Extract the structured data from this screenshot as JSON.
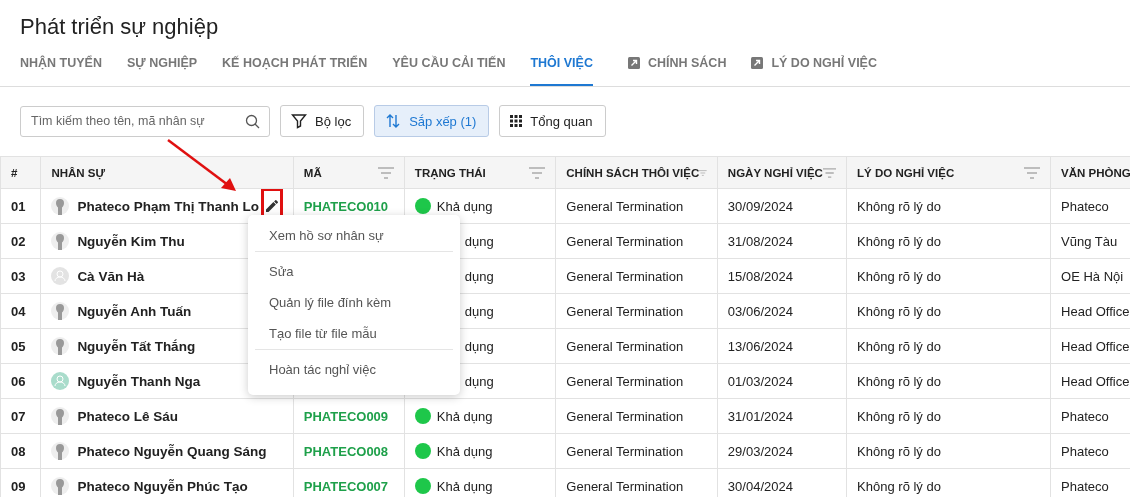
{
  "title": "Phát triển sự nghiệp",
  "tabs": [
    {
      "label": "NHẬN TUYỂN",
      "selected": false,
      "external": false
    },
    {
      "label": "SỰ NGHIỆP",
      "selected": false,
      "external": false
    },
    {
      "label": "KẾ HOẠCH PHÁT TRIỂN",
      "selected": false,
      "external": false
    },
    {
      "label": "YÊU CẦU CẢI TIẾN",
      "selected": false,
      "external": false
    },
    {
      "label": "THÔI VIỆC",
      "selected": true,
      "external": false
    },
    {
      "label": "CHÍNH SÁCH",
      "selected": false,
      "external": true
    },
    {
      "label": "LÝ DO NGHỈ VIỆC",
      "selected": false,
      "external": true
    }
  ],
  "search": {
    "placeholder": "Tìm kiếm theo tên, mã nhân sự"
  },
  "toolbar": [
    {
      "label": "Bộ lọc",
      "kind": "filter",
      "selected": false
    },
    {
      "label": "Sắp xếp (1)",
      "kind": "sort",
      "selected": true
    },
    {
      "label": "Tổng quan",
      "kind": "grid",
      "selected": false
    }
  ],
  "table": {
    "columns": [
      {
        "label": "#",
        "filter": false
      },
      {
        "label": "NHÂN SỰ",
        "filter": false
      },
      {
        "label": "MÃ",
        "filter": true
      },
      {
        "label": "TRẠNG THÁI",
        "filter": true
      },
      {
        "label": "CHÍNH SÁCH THÔI VIỆC",
        "filter": true
      },
      {
        "label": "NGÀY NGHỈ VIỆC",
        "filter": true
      },
      {
        "label": "LÝ DO NGHỈ VIỆC",
        "filter": true
      },
      {
        "label": "VĂN PHÒNG"
      }
    ],
    "rows": [
      {
        "no": "01",
        "avatar": {
          "kind": "photo"
        },
        "name": "Phateco Phạm Thị Thanh Lo",
        "actions": true,
        "code": "PHATECO010",
        "status": {
          "text": "Khả dụng",
          "kind": "dot",
          "color": "#1ec74a"
        },
        "policy": "General Termination",
        "date": "30/09/2024",
        "reason": "Không rõ lý do",
        "office": "Phateco"
      },
      {
        "no": "02",
        "avatar": {
          "kind": "photo"
        },
        "name": "Nguyễn Kim Thu",
        "status": {
          "text": "dụng",
          "kind": "clipped"
        },
        "policy": "General Termination",
        "date": "31/08/2024",
        "reason": "Không rõ lý do",
        "office": "Vũng Tàu"
      },
      {
        "no": "03",
        "avatar": {
          "kind": "blank"
        },
        "name": "Cà Văn Hà",
        "status": {
          "text": "dụng",
          "kind": "clipped"
        },
        "policy": "General Termination",
        "date": "15/08/2024",
        "reason": "Không rõ lý do",
        "office": "OE Hà Nội"
      },
      {
        "no": "04",
        "avatar": {
          "kind": "photo"
        },
        "name": "Nguyễn Anh Tuấn",
        "status": {
          "text": "dụng",
          "kind": "clipped"
        },
        "policy": "General Termination",
        "date": "03/06/2024",
        "reason": "Không rõ lý do",
        "office": "Head Office"
      },
      {
        "no": "05",
        "avatar": {
          "kind": "photo"
        },
        "name": "Nguyễn Tất Thắng",
        "status": {
          "text": "dụng",
          "kind": "clipped"
        },
        "policy": "General Termination",
        "date": "13/06/2024",
        "reason": "Không rõ lý do",
        "office": "Head Office"
      },
      {
        "no": "06",
        "avatar": {
          "kind": "teal"
        },
        "name": "Nguyễn Thanh Nga",
        "status": {
          "text": "dụng",
          "kind": "clipped"
        },
        "policy": "General Termination",
        "date": "01/03/2024",
        "reason": "Không rõ lý do",
        "office": "Head Office"
      },
      {
        "no": "07",
        "avatar": {
          "kind": "photo"
        },
        "name": "Phateco Lê Sáu",
        "code": "PHATECO009",
        "status": {
          "text": "Khả dụng",
          "kind": "dot",
          "color": "#1ec74a"
        },
        "policy": "General Termination",
        "date": "31/01/2024",
        "reason": "Không rõ lý do",
        "office": "Phateco"
      },
      {
        "no": "08",
        "avatar": {
          "kind": "photo"
        },
        "name": "Phateco Nguyễn Quang Sáng",
        "code": "PHATECO008",
        "status": {
          "text": "Khả dụng",
          "kind": "dot",
          "color": "#1ec74a"
        },
        "policy": "General Termination",
        "date": "29/03/2024",
        "reason": "Không rõ lý do",
        "office": "Phateco"
      },
      {
        "no": "09",
        "avatar": {
          "kind": "photo"
        },
        "name": "Phateco Nguyễn Phúc Tạo",
        "code": "PHATECO007",
        "status": {
          "text": "Khả dụng",
          "kind": "dot",
          "color": "#1ec74a"
        },
        "policy": "General Termination",
        "date": "30/04/2024",
        "reason": "Không rõ lý do",
        "office": "Phateco"
      }
    ]
  },
  "context_menu": [
    {
      "label": "Xem hồ sơ nhân sự",
      "divider_after": true
    },
    {
      "label": "Sửa",
      "divider_after": false
    },
    {
      "label": "Quản lý file đính kèm",
      "divider_after": false
    },
    {
      "label": "Tạo file từ file mẫu",
      "divider_after": true
    },
    {
      "label": "Hoàn tác nghỉ việc",
      "divider_after": false
    }
  ]
}
